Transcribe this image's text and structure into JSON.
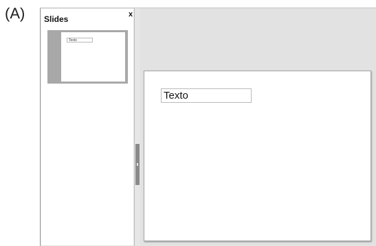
{
  "figure_label": "(A)",
  "slides_panel": {
    "title": "Slides",
    "close_symbol": "x",
    "thumbnails": [
      {
        "text": "Texto"
      }
    ]
  },
  "slide": {
    "text_box": "Texto"
  },
  "colors": {
    "workspace_bg": "#e2e2e2",
    "panel_bg": "#ffffff",
    "splitter": "#8a8a8a",
    "thumbnail_frame": "#a8a8a8"
  }
}
